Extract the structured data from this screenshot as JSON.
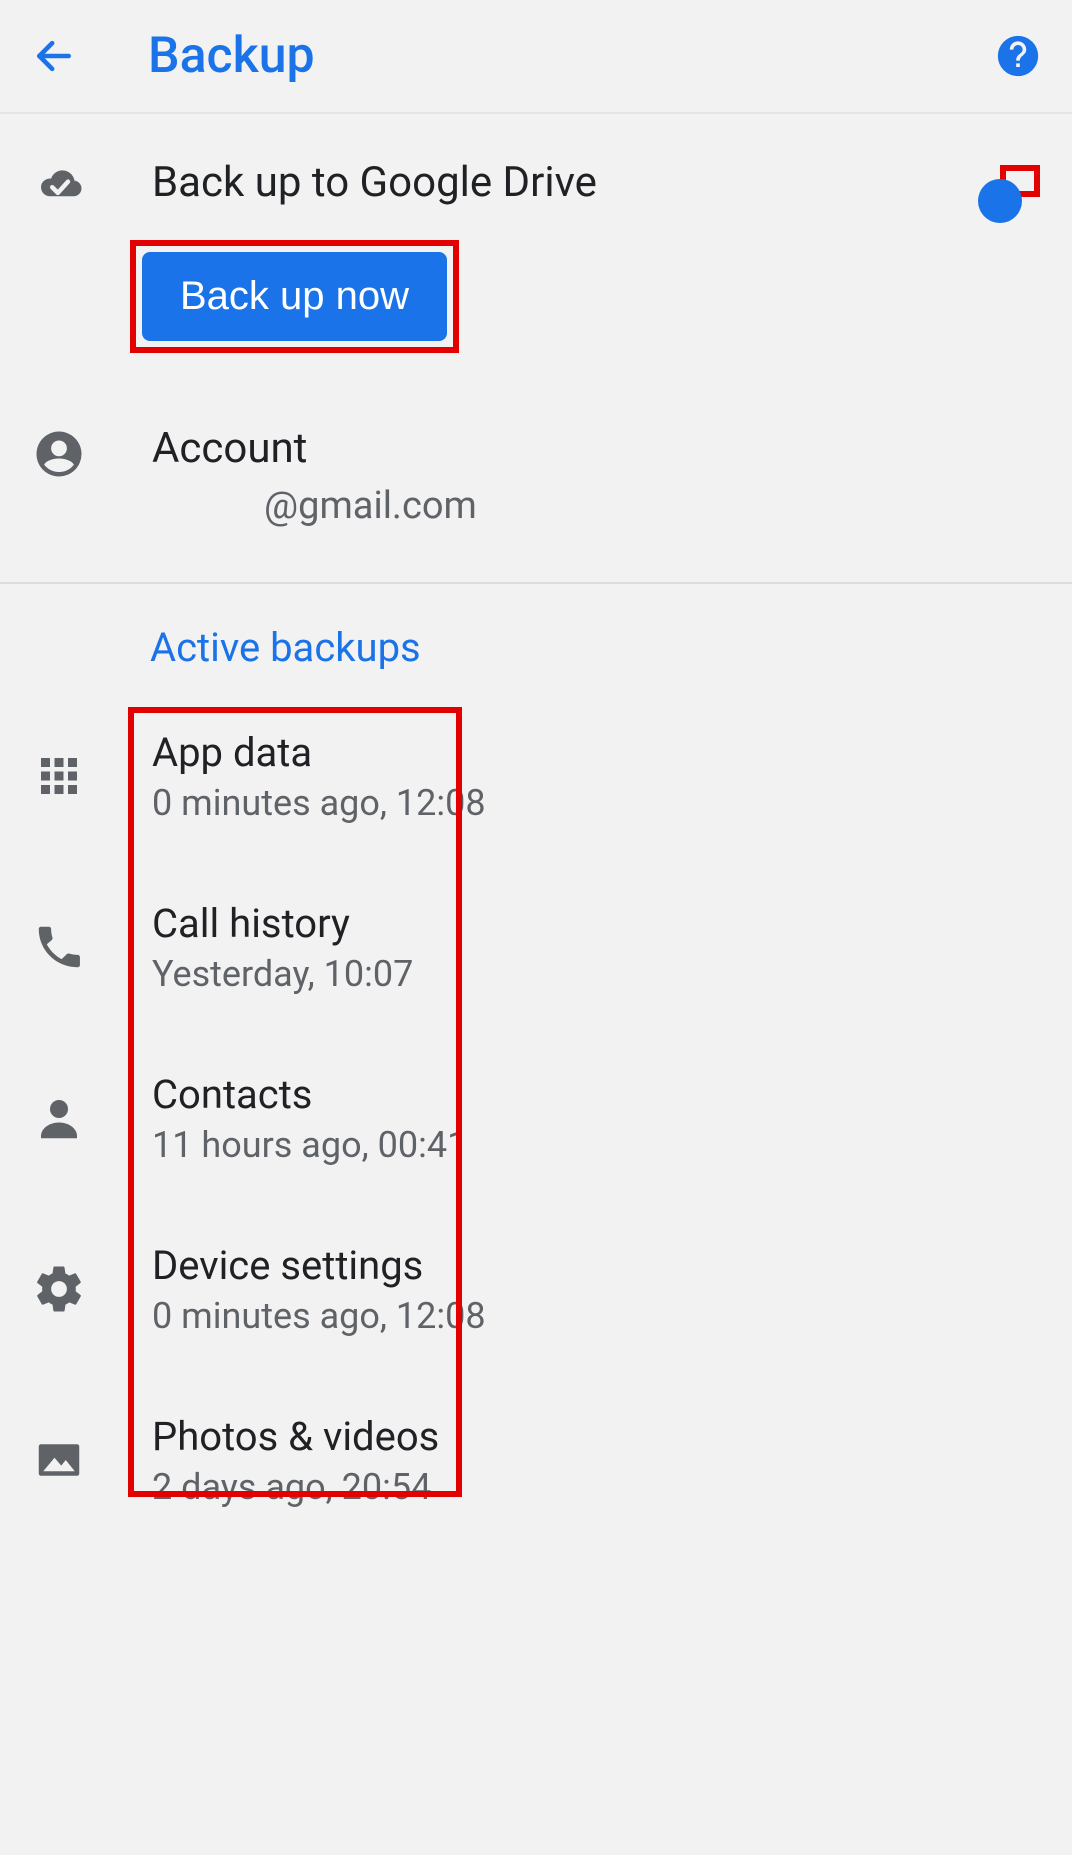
{
  "header": {
    "title": "Backup"
  },
  "backup_drive": {
    "title": "Back up to Google Drive",
    "toggle_on": true,
    "button_label": "Back up now"
  },
  "account": {
    "label": "Account",
    "email": "@gmail.com"
  },
  "active_section": {
    "title": "Active backups",
    "items": [
      {
        "icon": "apps-icon",
        "title": "App data",
        "sub": "0 minutes ago, 12:08"
      },
      {
        "icon": "phone-icon",
        "title": "Call history",
        "sub": "Yesterday, 10:07"
      },
      {
        "icon": "person-icon",
        "title": "Contacts",
        "sub": "11 hours ago, 00:41"
      },
      {
        "icon": "gear-icon",
        "title": "Device settings",
        "sub": "0 minutes ago, 12:08"
      },
      {
        "icon": "image-icon",
        "title": "Photos & videos",
        "sub": "2 days ago, 20:54"
      }
    ]
  },
  "colors": {
    "accent": "#1a73e8",
    "highlight": "#e30000",
    "text_secondary": "#5f6368"
  }
}
